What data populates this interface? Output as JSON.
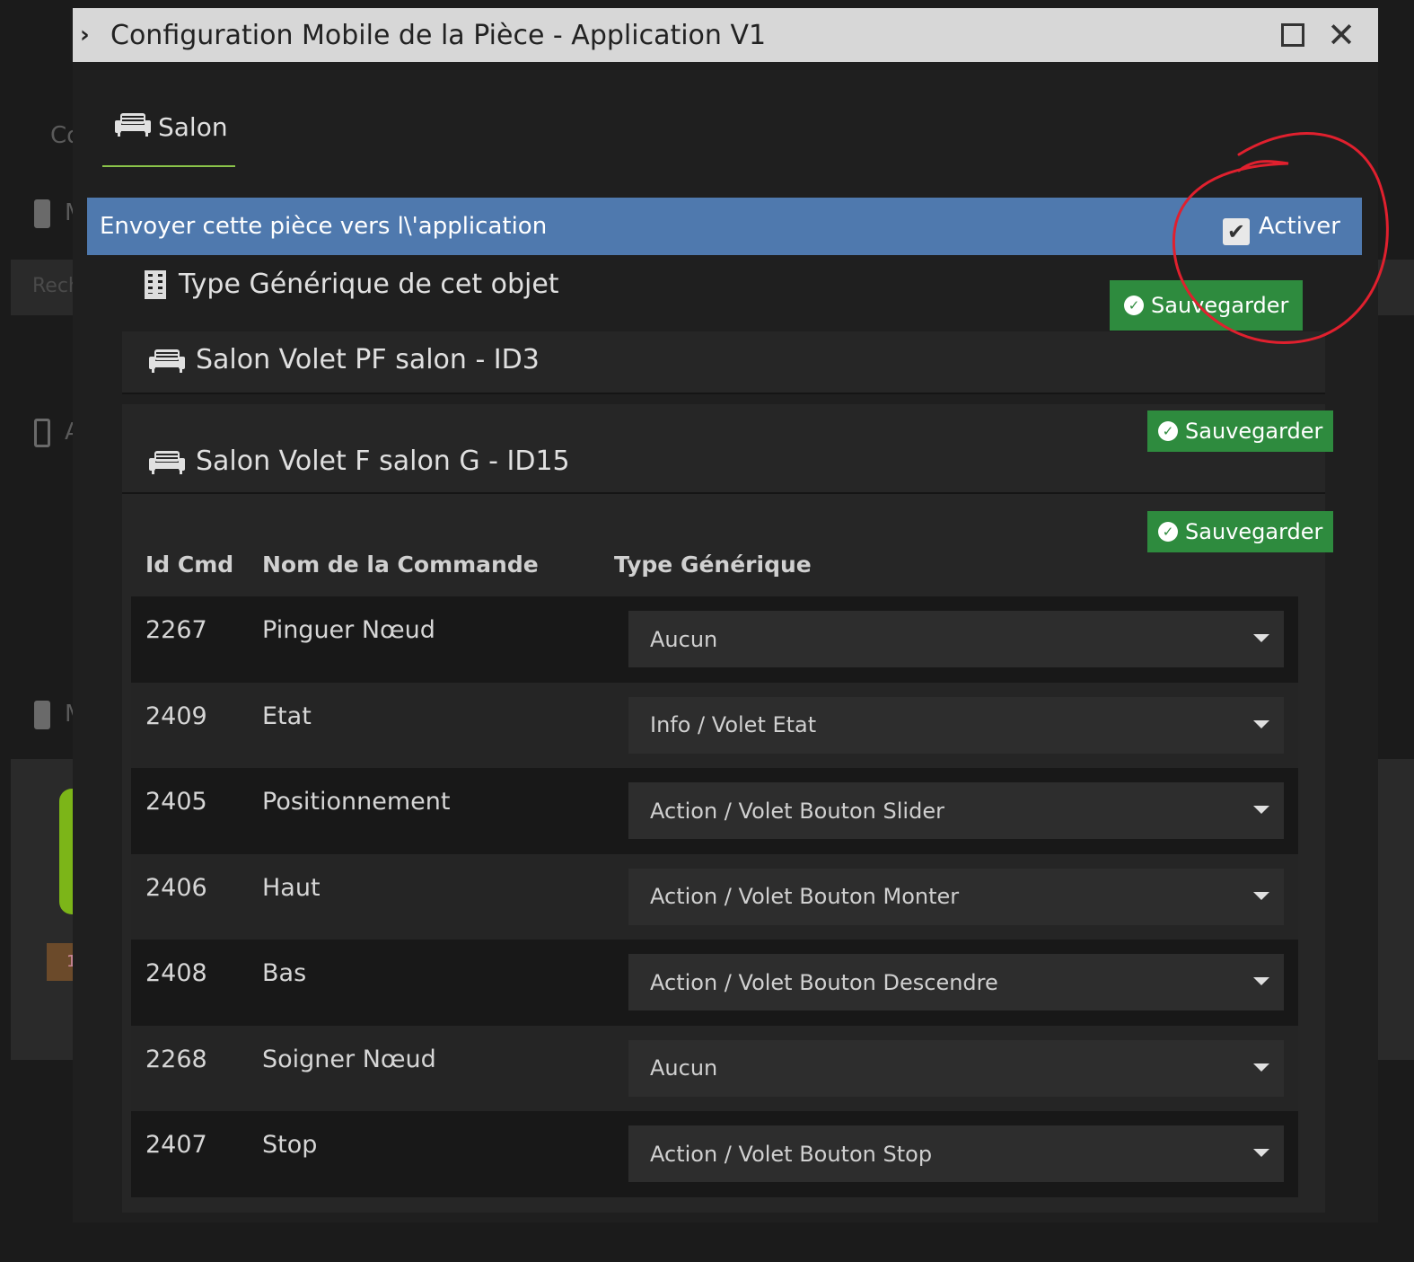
{
  "modal": {
    "title": "Configuration Mobile de la Pièce - Application V1"
  },
  "tabs": [
    {
      "label": "Salon"
    }
  ],
  "send_bar": {
    "label": "Envoyer cette pièce vers l\\'application",
    "toggle_label": "Activer",
    "checked": true
  },
  "generic_section": {
    "title": "Type Générique de cet objet",
    "save_label": "Sauvegarder"
  },
  "equipments": [
    {
      "title": "Salon Volet PF salon - ID3",
      "save_label": "Sauvegarder"
    },
    {
      "title": "Salon Volet F salon G - ID15",
      "save_label": "Sauvegarder"
    }
  ],
  "table": {
    "headers": [
      "Id Cmd",
      "Nom de la Commande",
      "Type Générique"
    ],
    "rows": [
      {
        "id": "2267",
        "name": "Pinguer Nœud",
        "type": "Aucun"
      },
      {
        "id": "2409",
        "name": "Etat",
        "type": "Info / Volet Etat"
      },
      {
        "id": "2405",
        "name": "Positionnement",
        "type": "Action / Volet Bouton Slider"
      },
      {
        "id": "2406",
        "name": "Haut",
        "type": "Action / Volet Bouton Monter"
      },
      {
        "id": "2408",
        "name": "Bas",
        "type": "Action / Volet Bouton Descendre"
      },
      {
        "id": "2268",
        "name": "Soigner Nœud",
        "type": "Aucun"
      },
      {
        "id": "2407",
        "name": "Stop",
        "type": "Action / Volet Bouton Stop"
      }
    ]
  },
  "background": {
    "fragments": [
      "Co",
      "Rech",
      "M",
      "A",
      "M",
      "1"
    ]
  },
  "colors": {
    "titlebar": "#d7d7d7",
    "send_bar": "#4f79ae",
    "save_button": "#2e8b3e",
    "tab_underline": "#8bc34a",
    "annotation": "#e0202e"
  },
  "icons": {
    "expand": "chevron-right-icon",
    "maximize": "maximize-icon",
    "close": "close-icon",
    "room": "sofa-icon",
    "generic": "building-icon",
    "save": "check-circle-icon",
    "select": "caret-down-icon"
  }
}
